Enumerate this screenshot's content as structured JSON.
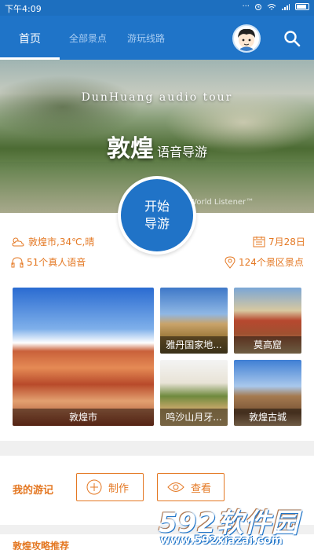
{
  "status_bar": {
    "time": "下午4:09"
  },
  "tabs": [
    {
      "label": "首页",
      "active": true
    },
    {
      "label": "全部景点",
      "active": false
    },
    {
      "label": "游玩线路",
      "active": false
    }
  ],
  "hero": {
    "subtitle": "DunHuang audio tour",
    "title_big": "敦煌",
    "title_small": "语音导游",
    "watermark": "y World Listener™"
  },
  "start_button": {
    "line1": "开始",
    "line2": "导游"
  },
  "info": {
    "weather": "敦煌市,34℃,晴",
    "date": "7月28日",
    "voices": "51个真人语音",
    "spots": "124个景区景点"
  },
  "spots": [
    {
      "name": "敦煌市"
    },
    {
      "name": "雅丹国家地..."
    },
    {
      "name": "莫高窟"
    },
    {
      "name": "鸣沙山月牙..."
    },
    {
      "name": "敦煌古城"
    }
  ],
  "travel": {
    "label": "我的游记",
    "make": "制作",
    "view": "查看"
  },
  "next_section": {
    "label": "敦煌攻略推荐"
  },
  "watermark": {
    "brand": "592软件园",
    "url": "www.592xiazai.com"
  },
  "colors": {
    "primary": "#1f74c8",
    "accent": "#e47823",
    "background": "#f0f0f0"
  }
}
